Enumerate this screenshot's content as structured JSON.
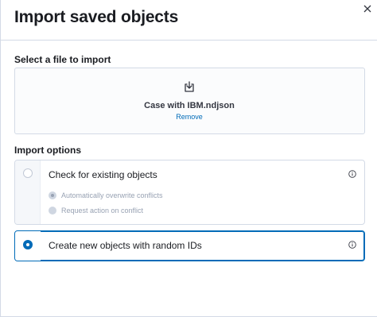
{
  "flyout": {
    "title": "Import saved objects",
    "close_icon": "cross-icon"
  },
  "file_section": {
    "label": "Select a file to import",
    "icon": "import-icon",
    "file_name": "Case with IBM.ndjson",
    "remove_label": "Remove"
  },
  "import_options": {
    "label": "Import options",
    "check_existing": {
      "title": "Check for existing objects",
      "selected": false,
      "sub_options": [
        {
          "label": "Automatically overwrite conflicts",
          "selected": true,
          "disabled": true
        },
        {
          "label": "Request action on conflict",
          "selected": false,
          "disabled": true
        }
      ],
      "info_icon": "info-icon"
    },
    "create_new": {
      "title": "Create new objects with random IDs",
      "selected": true,
      "info_icon": "info-icon"
    }
  },
  "colors": {
    "accent": "#006bb8",
    "border": "#d3dae6",
    "text": "#1a1c21",
    "muted": "#98a2b3"
  }
}
